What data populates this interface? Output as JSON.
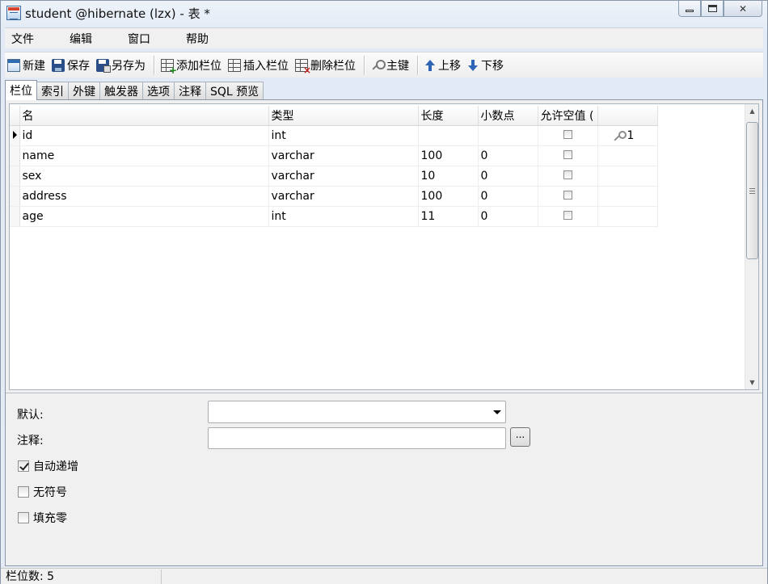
{
  "window": {
    "title": "student @hibernate (lzx) - 表 *",
    "min_label": "",
    "max_label": "",
    "close_label": "✕"
  },
  "menu": [
    "文件",
    "编辑",
    "窗口",
    "帮助"
  ],
  "toolbar": {
    "new": "新建",
    "save": "保存",
    "save_as": "另存为",
    "add_column": "添加栏位",
    "insert_column": "插入栏位",
    "delete_column": "删除栏位",
    "primary_key": "主键",
    "move_up": "上移",
    "move_down": "下移"
  },
  "tabs": [
    "栏位",
    "索引",
    "外键",
    "触发器",
    "选项",
    "注释",
    "SQL 预览"
  ],
  "grid": {
    "headers": [
      "名",
      "类型",
      "长度",
      "小数点",
      "允许空值 (",
      ""
    ],
    "rows": [
      {
        "name": "id",
        "type": "int",
        "length": "",
        "decimals": "",
        "allow_null": false,
        "key": "1"
      },
      {
        "name": "name",
        "type": "varchar",
        "length": "100",
        "decimals": "0",
        "allow_null": false,
        "key": ""
      },
      {
        "name": "sex",
        "type": "varchar",
        "length": "10",
        "decimals": "0",
        "allow_null": false,
        "key": ""
      },
      {
        "name": "address",
        "type": "varchar",
        "length": "100",
        "decimals": "0",
        "allow_null": false,
        "key": ""
      },
      {
        "name": "age",
        "type": "int",
        "length": "11",
        "decimals": "0",
        "allow_null": false,
        "key": ""
      }
    ]
  },
  "properties": {
    "default_label": "默认:",
    "default_value": "",
    "comment_label": "注释:",
    "comment_value": "",
    "ellipsis_label": "...",
    "auto_increment_label": "自动递增",
    "auto_increment": true,
    "unsigned_label": "无符号",
    "unsigned": false,
    "zerofill_label": "填充零",
    "zerofill": false
  },
  "status": {
    "column_count": "栏位数: 5"
  }
}
